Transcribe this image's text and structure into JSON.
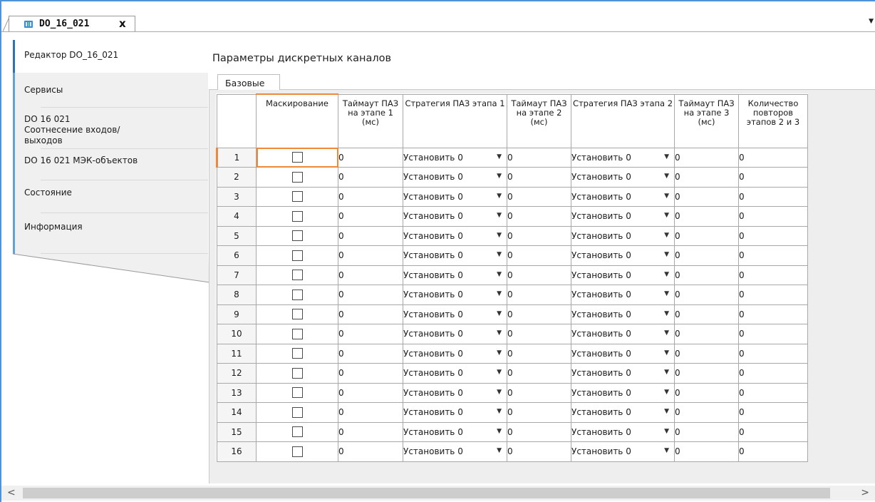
{
  "document_tab": {
    "title": "DO_16_021",
    "close_glyph": "x"
  },
  "sidebar": {
    "items": [
      {
        "label": "Редактор DO_16_021",
        "active": true
      },
      {
        "label": "Сервисы"
      },
      {
        "label": "DO 16 021 Соотнесение входов/выходов"
      },
      {
        "label": "DO 16 021 МЭК-объектов"
      },
      {
        "label": "Состояние"
      },
      {
        "label": "Информация"
      }
    ]
  },
  "section_title": "Параметры дискретных каналов",
  "group_tab": "Базовые",
  "table": {
    "headers": [
      "",
      "Маскирование",
      "Таймаут ПАЗ на этапе 1 (мс)",
      "Стратегия ПАЗ этапа 1",
      "Таймаут ПАЗ на этапе 2 (мс)",
      "Стратегия ПАЗ этапа 2",
      "Таймаут ПАЗ на этапе 3 (мс)",
      "Количество повторов этапов 2 и 3"
    ],
    "rows": [
      {
        "n": "1",
        "t1": "0",
        "s1": "Установить 0",
        "t2": "0",
        "s2": "Установить 0",
        "t3": "0",
        "rep": "0"
      },
      {
        "n": "2",
        "t1": "0",
        "s1": "Установить 0",
        "t2": "0",
        "s2": "Установить 0",
        "t3": "0",
        "rep": "0"
      },
      {
        "n": "3",
        "t1": "0",
        "s1": "Установить 0",
        "t2": "0",
        "s2": "Установить 0",
        "t3": "0",
        "rep": "0"
      },
      {
        "n": "4",
        "t1": "0",
        "s1": "Установить 0",
        "t2": "0",
        "s2": "Установить 0",
        "t3": "0",
        "rep": "0"
      },
      {
        "n": "5",
        "t1": "0",
        "s1": "Установить 0",
        "t2": "0",
        "s2": "Установить 0",
        "t3": "0",
        "rep": "0"
      },
      {
        "n": "6",
        "t1": "0",
        "s1": "Установить 0",
        "t2": "0",
        "s2": "Установить 0",
        "t3": "0",
        "rep": "0"
      },
      {
        "n": "7",
        "t1": "0",
        "s1": "Установить 0",
        "t2": "0",
        "s2": "Установить 0",
        "t3": "0",
        "rep": "0"
      },
      {
        "n": "8",
        "t1": "0",
        "s1": "Установить 0",
        "t2": "0",
        "s2": "Установить 0",
        "t3": "0",
        "rep": "0"
      },
      {
        "n": "9",
        "t1": "0",
        "s1": "Установить 0",
        "t2": "0",
        "s2": "Установить 0",
        "t3": "0",
        "rep": "0"
      },
      {
        "n": "10",
        "t1": "0",
        "s1": "Установить 0",
        "t2": "0",
        "s2": "Установить 0",
        "t3": "0",
        "rep": "0"
      },
      {
        "n": "11",
        "t1": "0",
        "s1": "Установить 0",
        "t2": "0",
        "s2": "Установить 0",
        "t3": "0",
        "rep": "0"
      },
      {
        "n": "12",
        "t1": "0",
        "s1": "Установить 0",
        "t2": "0",
        "s2": "Установить 0",
        "t3": "0",
        "rep": "0"
      },
      {
        "n": "13",
        "t1": "0",
        "s1": "Установить 0",
        "t2": "0",
        "s2": "Установить 0",
        "t3": "0",
        "rep": "0"
      },
      {
        "n": "14",
        "t1": "0",
        "s1": "Установить 0",
        "t2": "0",
        "s2": "Установить 0",
        "t3": "0",
        "rep": "0"
      },
      {
        "n": "15",
        "t1": "0",
        "s1": "Установить 0",
        "t2": "0",
        "s2": "Установить 0",
        "t3": "0",
        "rep": "0"
      },
      {
        "n": "16",
        "t1": "0",
        "s1": "Установить 0",
        "t2": "0",
        "s2": "Установить 0",
        "t3": "0",
        "rep": "0"
      }
    ]
  },
  "icons": {
    "document": "device-module-icon",
    "combo_arrow": "dropdown-arrow-icon",
    "scroll_left": "scroll-left-arrow-icon",
    "scroll_right": "scroll-right-arrow-icon"
  },
  "colors": {
    "selection_accent": "#f0883a",
    "sidebar_accent": "#5fa2dc",
    "window_frame": "#4f93d6"
  }
}
